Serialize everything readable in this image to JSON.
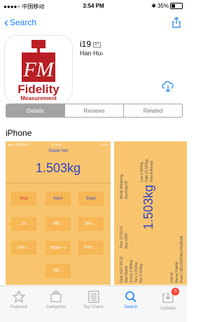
{
  "status_bar": {
    "carrier": "●●●●○ 中国移动 ",
    "time": "3:54 PM",
    "battery": "35%",
    "battery_level": 0.35
  },
  "nav": {
    "back_label": "Search"
  },
  "app": {
    "name": "i19",
    "age_rating": "4+",
    "developer": "Han Hu",
    "icon_wordmark": "Fidelity",
    "icon_subtitle": "Measurement"
  },
  "segments": [
    {
      "label": "Details",
      "active": true
    },
    {
      "label": "Reviews",
      "active": false
    },
    {
      "label": "Related",
      "active": false
    }
  ],
  "section_title": "iPhone",
  "screenshot1": {
    "status_carrier": "●●●○ 中国移动 令",
    "status_time": "下午5:00",
    "status_battery": "1 81%",
    "stable_label": "Stable  Net",
    "weight": "1.503kg",
    "buttons": [
      "Stop",
      "Keys",
      "Input",
      "→0←",
      "MR ↑",
      "Tare →",
      "Unit ←",
      "Prt/M+ ↵",
      "Func →",
      "MC ↓"
    ]
  },
  "screenshot2": {
    "weight": "1.503kg",
    "labels": [
      "Mode Weighing",
      "MaxCap 60",
      "Low 0.500kg",
      "High 12.523kg",
      "Result Accept",
      "Time 22:03:14",
      "Max 2003",
      "Date 2017-04-12",
      "Stat Stable",
      "Gross 2.589kg",
      "Tare 1.062kg",
      "Net 1.503kg",
      "Unit Id",
      "Name Fidelity",
      "Prod 7.0D17DPDKU7A02D1B"
    ]
  },
  "tabbar": [
    {
      "label": "Featured",
      "icon": "star-icon",
      "active": false
    },
    {
      "label": "Categories",
      "icon": "categories-icon",
      "active": false
    },
    {
      "label": "Top Charts",
      "icon": "list-icon",
      "active": false
    },
    {
      "label": "Search",
      "icon": "search-icon",
      "active": true
    },
    {
      "label": "Updates",
      "icon": "updates-icon",
      "active": false,
      "badge": "5"
    }
  ],
  "colors": {
    "accent": "#157efb",
    "brand_red": "#b91f24",
    "screenshot_bg": "#f8c56e",
    "button_bg": "#f7b755",
    "weight_blue": "#2f41c8",
    "badge_red": "#ff3b30"
  }
}
